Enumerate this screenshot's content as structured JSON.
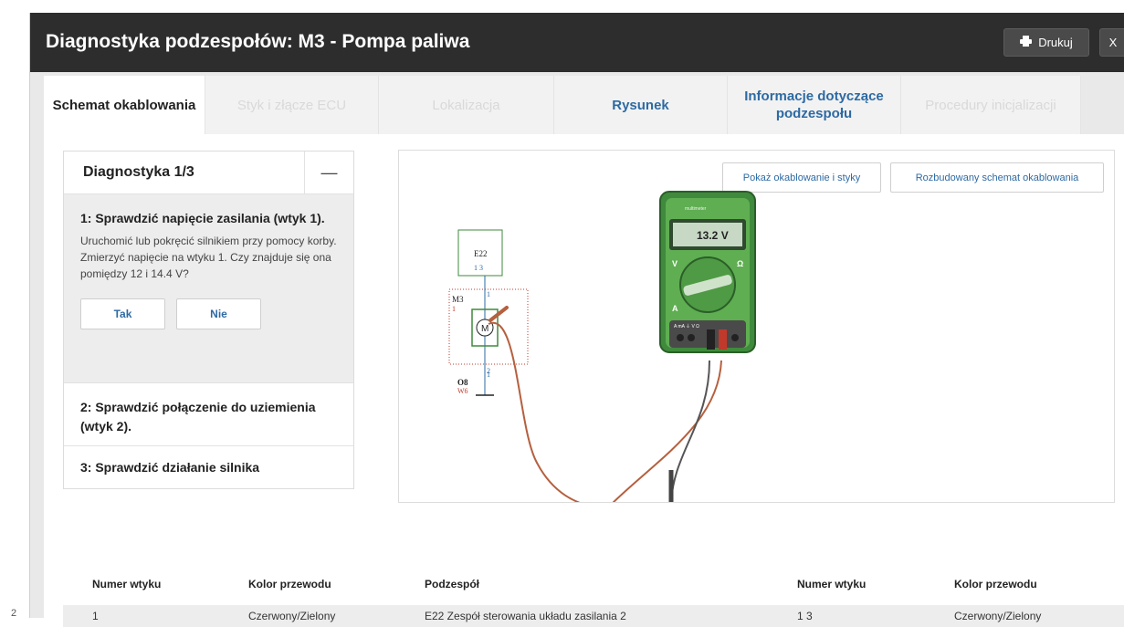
{
  "stray_mark": "2",
  "header": {
    "title": "Diagnostyka podzespołów: M3 - Pompa paliwa",
    "print_label": "Drukuj",
    "close_label": "X"
  },
  "tabs": [
    {
      "label": "Schemat okablowania",
      "state": "active"
    },
    {
      "label": "Styk i złącze ECU",
      "state": "disabled"
    },
    {
      "label": "Lokalizacja",
      "state": "disabled"
    },
    {
      "label": "Rysunek",
      "state": "enabled"
    },
    {
      "label": "Informacje dotyczące podzespołu",
      "state": "enabled"
    },
    {
      "label": "Procedury inicjalizacji",
      "state": "disabled"
    }
  ],
  "diagnostics": {
    "title": "Diagnostyka 1/3",
    "collapse_symbol": "—",
    "step1": {
      "title": "1: Sprawdzić napięcie zasilania (wtyk 1).",
      "text": "Uruchomić lub pokręcić silnikiem przy pomocy korby. Zmierzyć napięcie na wtyku 1. Czy znajduje się ona pomiędzy 12 i 14.4 V?",
      "yes_label": "Tak",
      "no_label": "Nie"
    },
    "step2": {
      "title": "2: Sprawdzić połączenie do uziemienia (wtyk 2)."
    },
    "step3": {
      "title": "3: Sprawdzić działanie silnika"
    }
  },
  "diagram": {
    "show_wiring_button": "Pokaż okablowanie i styky",
    "extended_schema_button": "Rozbudowany schemat okablowania",
    "e22_label": "E22",
    "e22_pins": "1 3",
    "m3_label": "M3",
    "m3_pin_top": "1",
    "m3_side_mark": "1",
    "m3_pin_bottom": "2",
    "motor_symbol": "M",
    "ground_label": "O8",
    "ground_sub": "W6",
    "ground_pin": "1",
    "meter_reading": "13.2 V",
    "meter_dial_left": "V",
    "meter_dial_right": "Ω",
    "meter_dial_bottom": "A",
    "meter_jacks": "A  mA  ⏚  V  Ω",
    "meter_brand": "multimeter",
    "icon": "multimeter-icon"
  },
  "connections_table": {
    "columns": [
      "Numer wtyku",
      "Kolor przewodu",
      "Podzespół",
      "Numer wtyku",
      "Kolor przewodu"
    ],
    "rows": [
      [
        "1",
        "Czerwony/Zielony",
        "E22 Zespół sterowania układu zasilania 2",
        "1 3",
        "Czerwony/Zielony"
      ]
    ]
  },
  "colors": {
    "header_bg": "#2d2d2d",
    "link_blue": "#2d6aa3",
    "meter_green": "#3f8a3c",
    "probe_red": "#c0392b",
    "wire_brown": "#b5603f"
  }
}
